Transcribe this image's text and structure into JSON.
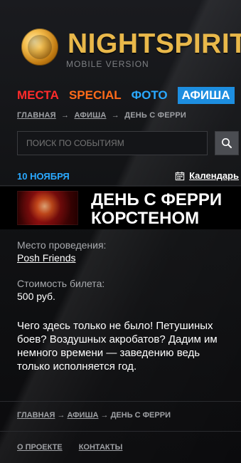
{
  "brand": {
    "name": "NIGHTSPIRIT",
    "subtitle": "MOBILE VERSION"
  },
  "nav": [
    {
      "label": "МЕСТА"
    },
    {
      "label": "SPECIAL"
    },
    {
      "label": "ФОТО"
    },
    {
      "label": "АФИША"
    }
  ],
  "breadcrumbs_top": {
    "home": "ГЛАВНАЯ",
    "arrow1": "→",
    "afisha": "АФИША",
    "arrow2": "→",
    "current": "ДЕНЬ С ФЕРРИ"
  },
  "search": {
    "placeholder": "ПОИСК ПО СОБЫТИЯМ"
  },
  "date_row": {
    "date": "10 НОЯБРЯ",
    "calendar_label": "Календарь"
  },
  "event": {
    "title_line1": "ДЕНЬ С ФЕРРИ",
    "title_line2": "КОРСТЕНОМ"
  },
  "details": {
    "venue_label": "Место проведения:",
    "venue_value": "Posh Friends",
    "ticket_label": "Стоимость билета:",
    "ticket_value": "500 руб."
  },
  "description": {
    "text": "Чего здесь только не было! Петушиных боев? Воздушных акробатов? Дадим им немного времени — заведению ведь только исполняется год."
  },
  "breadcrumbs_bottom": {
    "home": "ГЛАВНАЯ",
    "arrow1": "→",
    "afisha": "АФИША",
    "arrow2": "→",
    "current": "ДЕНЬ С ФЕРРИ"
  },
  "footer": {
    "about": "О ПРОЕКТЕ",
    "contacts": "КОНТАКТЫ"
  },
  "colors": {
    "nav_mesta": "#ff2b2b",
    "nav_special": "#ff6b1a",
    "nav_foto": "#2aa9ff",
    "nav_afisha_bg": "#1d8ee0",
    "date": "#2aa9ff",
    "logo": "#e9b84a"
  },
  "icons": {
    "logo": "nightspirit-logo-icon",
    "search": "search-icon",
    "calendar": "calendar-icon"
  }
}
